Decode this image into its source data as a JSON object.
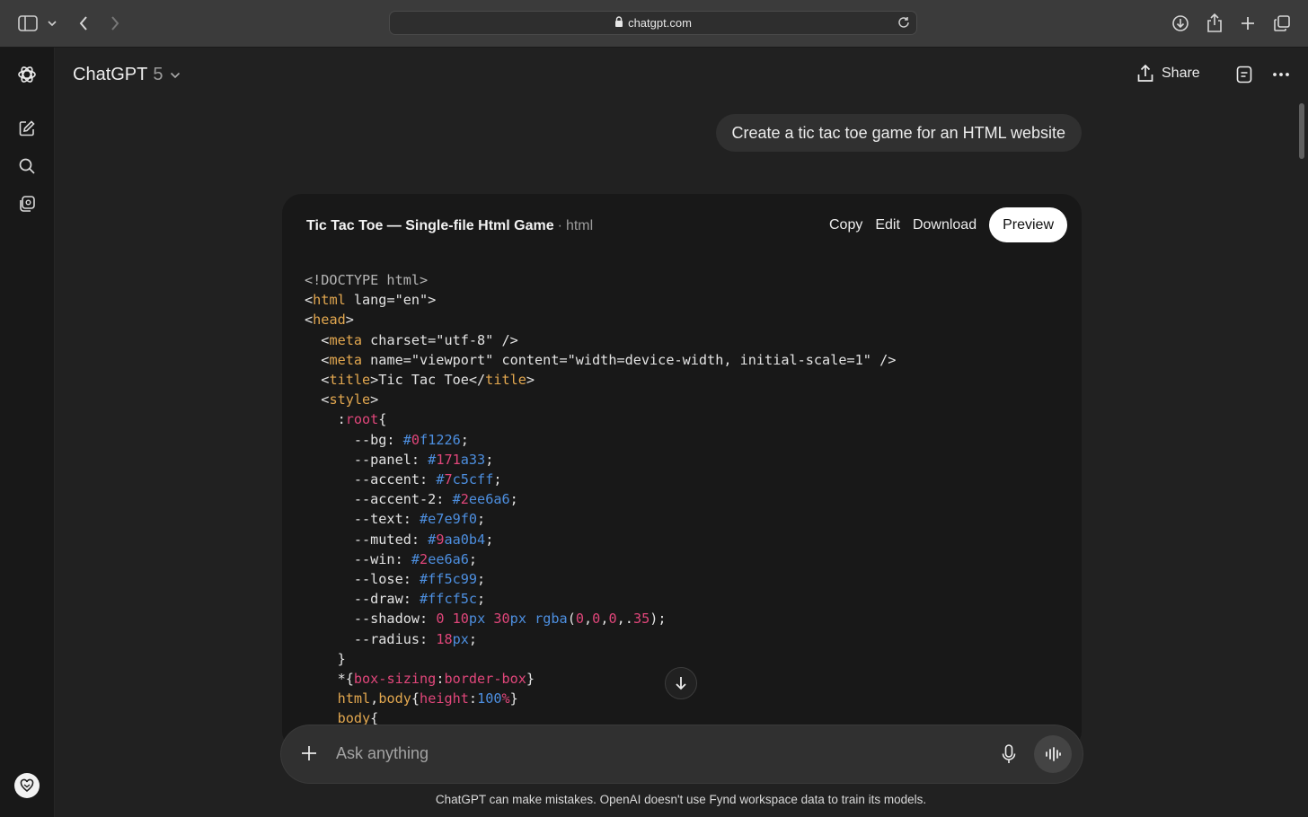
{
  "browser": {
    "url": "chatgpt.com"
  },
  "header": {
    "model_name": "ChatGPT",
    "model_version": "5",
    "share_label": "Share"
  },
  "conversation": {
    "user_message": "Create a tic tac toe game for an HTML website"
  },
  "canvas": {
    "title": "Tic Tac Toe — Single-file Html Game",
    "separator": "·",
    "language": "html",
    "actions": {
      "copy": "Copy",
      "edit": "Edit",
      "download": "Download",
      "preview": "Preview"
    },
    "code_lines": [
      "<!DOCTYPE html>",
      "<html lang=\"en\">",
      "<head>",
      "  <meta charset=\"utf-8\" />",
      "  <meta name=\"viewport\" content=\"width=device-width, initial-scale=1\" />",
      "  <title>Tic Tac Toe</title>",
      "  <style>",
      "    :root{",
      "      --bg: #0f1226;",
      "      --panel: #171a33;",
      "      --accent: #7c5cff;",
      "      --accent-2: #2ee6a6;",
      "      --text: #e7e9f0;",
      "      --muted: #9aa0b4;",
      "      --win: #2ee6a6;",
      "      --lose: #ff5c99;",
      "      --draw: #ffcf5c;",
      "      --shadow: 0 10px 30px rgba(0,0,0,.35);",
      "      --radius: 18px;",
      "    }",
      "    *{box-sizing:border-box}",
      "    html,body{height:100%}",
      "    body{"
    ]
  },
  "composer": {
    "placeholder": "Ask anything"
  },
  "footer": {
    "disclaimer": "ChatGPT can make mistakes. OpenAI doesn't use Fynd workspace data to train its models."
  },
  "icons": {
    "sidebar_toggle": "sidebar-icon",
    "back": "chevron-left-icon",
    "forward": "chevron-right-icon",
    "downloads": "download-icon",
    "share_sheet": "share-icon",
    "new_tab": "plus-icon",
    "tabs": "tabs-icon",
    "logo": "openai-logo-icon",
    "new_chat": "edit-icon",
    "search": "search-icon",
    "library": "library-icon"
  },
  "colors": {
    "background": "#212121",
    "rail": "#181818",
    "card": "#181818",
    "composer": "#303030",
    "tag": "#e2a74f",
    "attr": "#e0467a",
    "string": "#2ea37a",
    "number": "#4d8fe0"
  }
}
